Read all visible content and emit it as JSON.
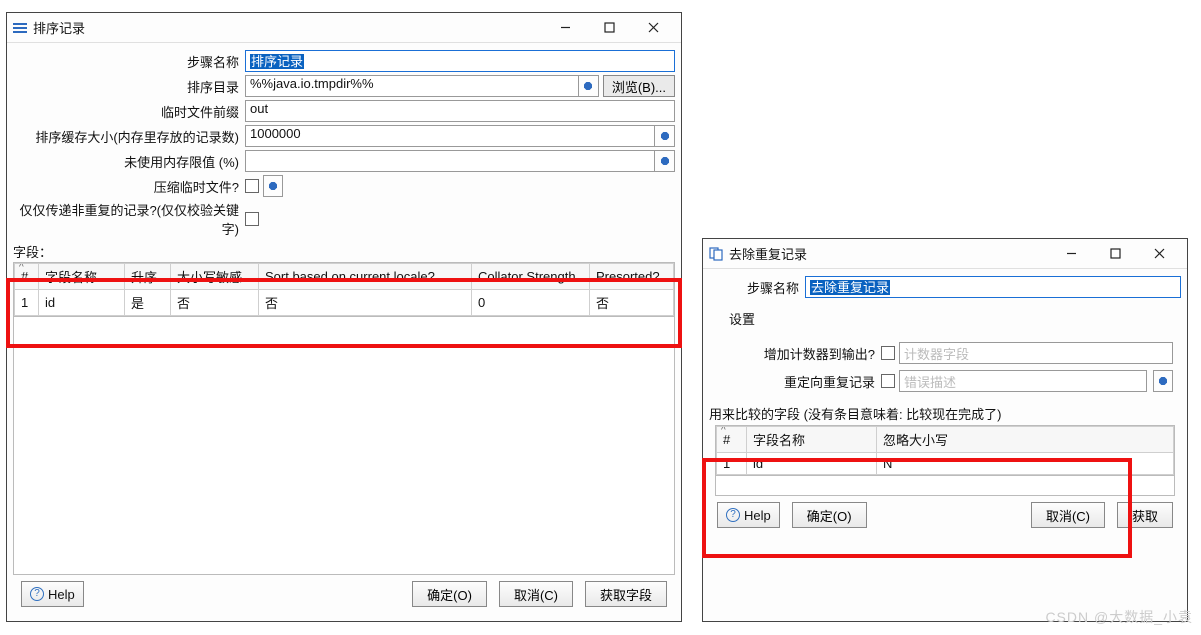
{
  "left": {
    "title": "排序记录",
    "fields": {
      "stepName": {
        "label": "步骤名称",
        "value": "排序记录"
      },
      "sortDir": {
        "label": "排序目录",
        "value": "%%java.io.tmpdir%%"
      },
      "tmpPrefix": {
        "label": "临时文件前缀",
        "value": "out"
      },
      "bufSize": {
        "label": "排序缓存大小(内存里存放的记录数)",
        "value": "1000000"
      },
      "freeMem": {
        "label": "未使用内存限值 (%)",
        "value": ""
      },
      "compress": {
        "label": "压缩临时文件?"
      },
      "unique": {
        "label": "仅仅传递非重复的记录?(仅仅校验关键字)"
      }
    },
    "browse": "浏览(B)...",
    "fieldsLabel": "字段：",
    "table": {
      "cols": [
        "#",
        "字段名称",
        "升序",
        "大小写敏感",
        "Sort based on current locale?",
        "Collator Strength",
        "Presorted?"
      ],
      "row": [
        "1",
        "id",
        "是",
        "否",
        "否",
        "0",
        "否"
      ]
    },
    "buttons": {
      "help": "Help",
      "ok": "确定(O)",
      "cancel": "取消(C)",
      "get": "获取字段"
    }
  },
  "right": {
    "title": "去除重复记录",
    "stepName": {
      "label": "步骤名称",
      "value": "去除重复记录"
    },
    "settingsLegend": "设置",
    "counter": {
      "label": "增加计数器到输出?",
      "placeholder": "计数器字段"
    },
    "redirect": {
      "label": "重定向重复记录",
      "placeholder": "错误描述"
    },
    "compareLabel": "用来比较的字段 (没有条目意味着: 比较现在完成了)",
    "table": {
      "cols": [
        "#",
        "字段名称",
        "忽略大小写"
      ],
      "row": [
        "1",
        "id",
        "N"
      ]
    },
    "buttons": {
      "help": "Help",
      "ok": "确定(O)",
      "cancel": "取消(C)",
      "get": "获取"
    }
  },
  "watermark": "CSDN @大数据_小袁"
}
